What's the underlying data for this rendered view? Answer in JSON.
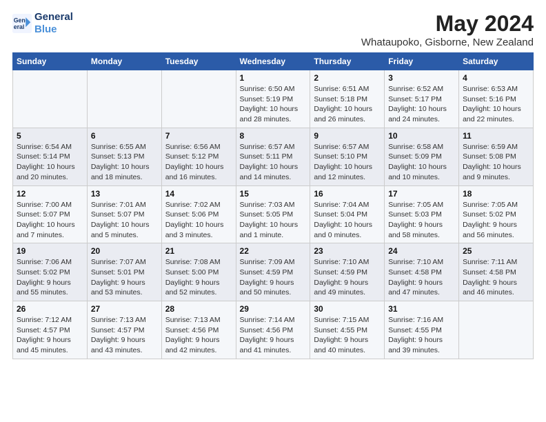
{
  "logo": {
    "line1": "General",
    "line2": "Blue"
  },
  "title": "May 2024",
  "subtitle": "Whataupoko, Gisborne, New Zealand",
  "days_header": [
    "Sunday",
    "Monday",
    "Tuesday",
    "Wednesday",
    "Thursday",
    "Friday",
    "Saturday"
  ],
  "weeks": [
    [
      {
        "day": "",
        "info": ""
      },
      {
        "day": "",
        "info": ""
      },
      {
        "day": "",
        "info": ""
      },
      {
        "day": "1",
        "info": "Sunrise: 6:50 AM\nSunset: 5:19 PM\nDaylight: 10 hours\nand 28 minutes."
      },
      {
        "day": "2",
        "info": "Sunrise: 6:51 AM\nSunset: 5:18 PM\nDaylight: 10 hours\nand 26 minutes."
      },
      {
        "day": "3",
        "info": "Sunrise: 6:52 AM\nSunset: 5:17 PM\nDaylight: 10 hours\nand 24 minutes."
      },
      {
        "day": "4",
        "info": "Sunrise: 6:53 AM\nSunset: 5:16 PM\nDaylight: 10 hours\nand 22 minutes."
      }
    ],
    [
      {
        "day": "5",
        "info": "Sunrise: 6:54 AM\nSunset: 5:14 PM\nDaylight: 10 hours\nand 20 minutes."
      },
      {
        "day": "6",
        "info": "Sunrise: 6:55 AM\nSunset: 5:13 PM\nDaylight: 10 hours\nand 18 minutes."
      },
      {
        "day": "7",
        "info": "Sunrise: 6:56 AM\nSunset: 5:12 PM\nDaylight: 10 hours\nand 16 minutes."
      },
      {
        "day": "8",
        "info": "Sunrise: 6:57 AM\nSunset: 5:11 PM\nDaylight: 10 hours\nand 14 minutes."
      },
      {
        "day": "9",
        "info": "Sunrise: 6:57 AM\nSunset: 5:10 PM\nDaylight: 10 hours\nand 12 minutes."
      },
      {
        "day": "10",
        "info": "Sunrise: 6:58 AM\nSunset: 5:09 PM\nDaylight: 10 hours\nand 10 minutes."
      },
      {
        "day": "11",
        "info": "Sunrise: 6:59 AM\nSunset: 5:08 PM\nDaylight: 10 hours\nand 9 minutes."
      }
    ],
    [
      {
        "day": "12",
        "info": "Sunrise: 7:00 AM\nSunset: 5:07 PM\nDaylight: 10 hours\nand 7 minutes."
      },
      {
        "day": "13",
        "info": "Sunrise: 7:01 AM\nSunset: 5:07 PM\nDaylight: 10 hours\nand 5 minutes."
      },
      {
        "day": "14",
        "info": "Sunrise: 7:02 AM\nSunset: 5:06 PM\nDaylight: 10 hours\nand 3 minutes."
      },
      {
        "day": "15",
        "info": "Sunrise: 7:03 AM\nSunset: 5:05 PM\nDaylight: 10 hours\nand 1 minute."
      },
      {
        "day": "16",
        "info": "Sunrise: 7:04 AM\nSunset: 5:04 PM\nDaylight: 10 hours\nand 0 minutes."
      },
      {
        "day": "17",
        "info": "Sunrise: 7:05 AM\nSunset: 5:03 PM\nDaylight: 9 hours\nand 58 minutes."
      },
      {
        "day": "18",
        "info": "Sunrise: 7:05 AM\nSunset: 5:02 PM\nDaylight: 9 hours\nand 56 minutes."
      }
    ],
    [
      {
        "day": "19",
        "info": "Sunrise: 7:06 AM\nSunset: 5:02 PM\nDaylight: 9 hours\nand 55 minutes."
      },
      {
        "day": "20",
        "info": "Sunrise: 7:07 AM\nSunset: 5:01 PM\nDaylight: 9 hours\nand 53 minutes."
      },
      {
        "day": "21",
        "info": "Sunrise: 7:08 AM\nSunset: 5:00 PM\nDaylight: 9 hours\nand 52 minutes."
      },
      {
        "day": "22",
        "info": "Sunrise: 7:09 AM\nSunset: 4:59 PM\nDaylight: 9 hours\nand 50 minutes."
      },
      {
        "day": "23",
        "info": "Sunrise: 7:10 AM\nSunset: 4:59 PM\nDaylight: 9 hours\nand 49 minutes."
      },
      {
        "day": "24",
        "info": "Sunrise: 7:10 AM\nSunset: 4:58 PM\nDaylight: 9 hours\nand 47 minutes."
      },
      {
        "day": "25",
        "info": "Sunrise: 7:11 AM\nSunset: 4:58 PM\nDaylight: 9 hours\nand 46 minutes."
      }
    ],
    [
      {
        "day": "26",
        "info": "Sunrise: 7:12 AM\nSunset: 4:57 PM\nDaylight: 9 hours\nand 45 minutes."
      },
      {
        "day": "27",
        "info": "Sunrise: 7:13 AM\nSunset: 4:57 PM\nDaylight: 9 hours\nand 43 minutes."
      },
      {
        "day": "28",
        "info": "Sunrise: 7:13 AM\nSunset: 4:56 PM\nDaylight: 9 hours\nand 42 minutes."
      },
      {
        "day": "29",
        "info": "Sunrise: 7:14 AM\nSunset: 4:56 PM\nDaylight: 9 hours\nand 41 minutes."
      },
      {
        "day": "30",
        "info": "Sunrise: 7:15 AM\nSunset: 4:55 PM\nDaylight: 9 hours\nand 40 minutes."
      },
      {
        "day": "31",
        "info": "Sunrise: 7:16 AM\nSunset: 4:55 PM\nDaylight: 9 hours\nand 39 minutes."
      },
      {
        "day": "",
        "info": ""
      }
    ]
  ]
}
